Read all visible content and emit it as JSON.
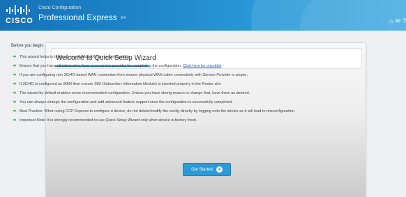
{
  "header": {
    "logo_text": "CISCO",
    "product_line": "Cisco Configuration",
    "product_name": "Professional Express",
    "version": "3.4"
  },
  "wizard": {
    "title": "Welcome to Quick Setup Wizard",
    "intro": "Before you begin:",
    "items": [
      {
        "text": "This wizard helps to bring up your WAN/LAN connectivity quickly."
      },
      {
        "text": "Ensure that you have all information from your service provider for completing the configuration. ",
        "link": "Click here for checklist"
      },
      {
        "text": "If you are configuring non 3G/4G based WAN connection then ensure physical WAN cable connectivity with Service Provider is proper."
      },
      {
        "text": "If 3G/4G is configured as WAN then ensure SIM (Subscriber Information Module) is inserted properly in the Router slot."
      },
      {
        "text": "The wizard by default enables some recommended configuration. Unless you have strong reason to change that, have them as desired."
      },
      {
        "text": "You can always change the configuration and add advanced feature support once the configuration is successfully completed."
      },
      {
        "text": "Best Practice: When using CCP Express to configure a device, do not delete/modify the config directly by logging onto the device as it will lead to misconfiguration."
      },
      {
        "text": "Important Note: It is strongly recommended to use Quick Setup Wizard only when device is factory fresh."
      }
    ],
    "button_label": "Get Started"
  }
}
